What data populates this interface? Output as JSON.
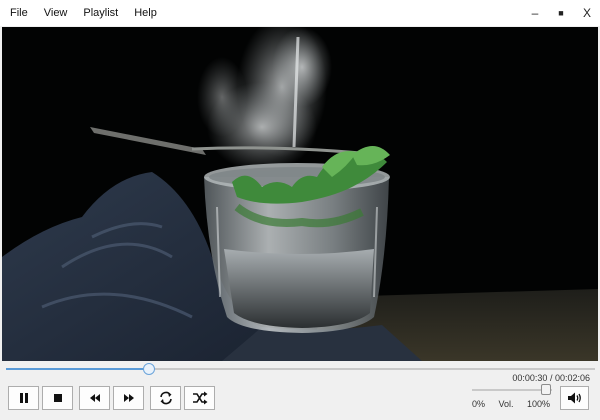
{
  "menu": {
    "file": "File",
    "view": "View",
    "playlist": "Playlist",
    "help": "Help"
  },
  "window_controls": {
    "minimize": "–",
    "maximize": "■",
    "close": "X"
  },
  "video": {
    "scene": "glass of water with mint and steam"
  },
  "playback": {
    "progress_fraction": 0.242,
    "current_time": "00:00:30",
    "separator": " / ",
    "total_time": "00:02:06"
  },
  "controls": {
    "pause_icon": "pause-icon",
    "stop_icon": "stop-icon",
    "rewind_icon": "rewind-icon",
    "fast_forward_icon": "fast-forward-icon",
    "repeat_icon": "repeat-icon",
    "shuffle_icon": "shuffle-icon"
  },
  "volume": {
    "level_fraction": 0.92,
    "min_label": "0%",
    "label": "Vol.",
    "max_label": "100%",
    "speaker_icon": "speaker-icon"
  },
  "colors": {
    "accent": "#5a9bd8",
    "video_background": "#020303"
  }
}
